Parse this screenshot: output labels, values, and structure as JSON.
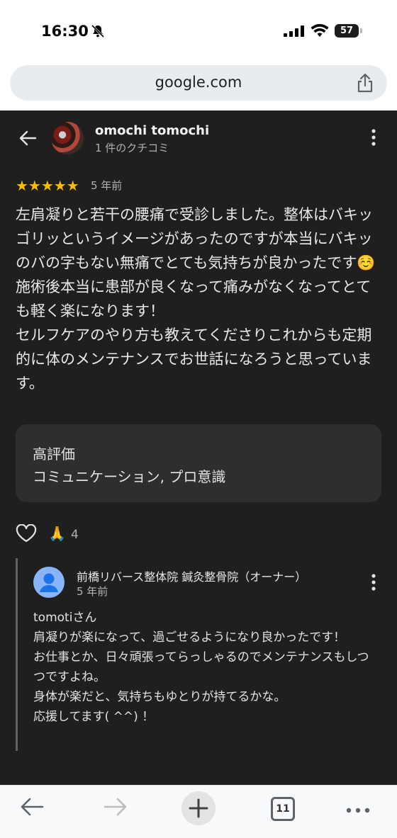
{
  "status": {
    "time": "16:30",
    "battery": "57"
  },
  "browser": {
    "url": "google.com",
    "tab_count": "11"
  },
  "review": {
    "reviewer_name": "omochi tomochi",
    "reviewer_sub": "1 件のクチコミ",
    "stars": "★★★★★",
    "rating": 5,
    "ago": "5 年前",
    "text": "左肩凝りと若干の腰痛で受診しました。整体はバキッゴリッというイメージがあったのですが本当にバキッのバの字もない無痛でとても気持ちが良かったです☺️\n施術後本当に患部が良くなって痛みがなくなってとても軽く楽になります！\nセルフケアのやり方も教えてくださりこれからも定期的に体のメンテナンスでお世話になろうと思っています。",
    "highlight_title": "高評価",
    "highlight_value": "コミュニケーション, プロ意識",
    "reaction_emoji": "🙏",
    "reaction_count": "4"
  },
  "owner_reply": {
    "name": "前橋リバース整体院 鍼灸整骨院（オーナー）",
    "ago": "5 年前",
    "text": "tomotiさん\n肩凝りが楽になって、過ごせるようになり良かったです！\nお仕事とか、日々頑張ってらっしゃるのでメンテナンスもしつつですよね。\n身体が楽だと、気持ちもゆとりが持てるかな。\n応援してます( ^^) ！"
  },
  "colors": {
    "background": "#1f1f1f",
    "star": "#fbbc04",
    "card": "#2d2e30"
  }
}
